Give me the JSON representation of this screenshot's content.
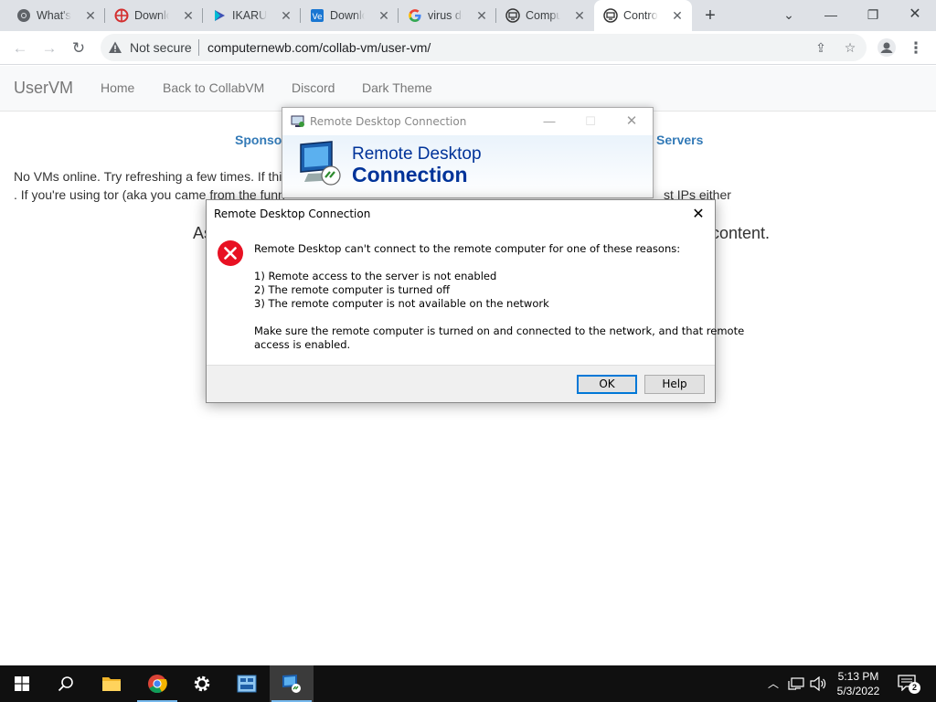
{
  "browser": {
    "tabs": [
      {
        "title": "What's i",
        "icon": "chrome-icon"
      },
      {
        "title": "Downlo",
        "icon": "download-site-icon"
      },
      {
        "title": "IKARUS",
        "icon": "play-icon"
      },
      {
        "title": "Downlo",
        "icon": "ve-icon"
      },
      {
        "title": "virus do",
        "icon": "google-icon"
      },
      {
        "title": "Comput",
        "icon": "vm-icon"
      },
      {
        "title": "Control",
        "icon": "vm-icon"
      }
    ],
    "active_tab": 6,
    "security_label": "Not secure",
    "url": "computernewb.com/collab-vm/user-vm/"
  },
  "page": {
    "brand": "UserVM",
    "nav": [
      "Home",
      "Back to CollabVM",
      "Discord",
      "Dark Theme"
    ],
    "sponsor_left": "Sponso",
    "sponsor_right": "Servers",
    "line1": "No VMs online. Try refreshing a few times. If thi",
    "line2": ". If you're using tor (aka you came from the funn",
    "line2_right": "st IPs either",
    "big_left": "As",
    "big_right": "content."
  },
  "rdc_window": {
    "title": "Remote Desktop Connection",
    "banner_line1": "Remote Desktop",
    "banner_line2": "Connection"
  },
  "dialog": {
    "title": "Remote Desktop Connection",
    "message": "Remote Desktop can't connect to the remote computer for one of these reasons:",
    "reasons": [
      "1) Remote access to the server is not enabled",
      "2) The remote computer is turned off",
      "3) The remote computer is not available on the network"
    ],
    "advice_1": "Make sure the remote computer is turned on and connected to the network, and that remote",
    "advice_2": "access is enabled.",
    "ok_label": "OK",
    "help_label": "Help"
  },
  "taskbar": {
    "time": "5:13 PM",
    "date": "5/3/2022",
    "notification_count": "2"
  },
  "colors": {
    "accent": "#0078d7",
    "link": "#337ab7",
    "rdc_blue": "#003399",
    "error_red": "#e81123"
  }
}
